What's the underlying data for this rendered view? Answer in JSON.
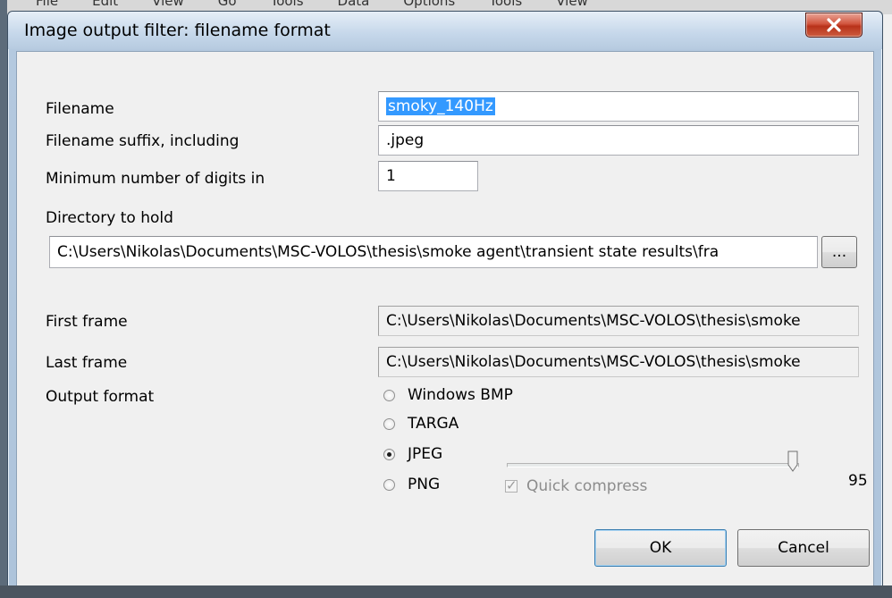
{
  "parent_menu": [
    "File",
    "Edit",
    "View",
    "Go",
    "Tools",
    "Data",
    "Options",
    "Tools",
    "View"
  ],
  "dialog": {
    "title": "Image output filter: filename format",
    "close_label": "x"
  },
  "form": {
    "filename_label": "Filename",
    "filename_value": "smoky_140Hz",
    "suffix_label": "Filename suffix, including",
    "suffix_value": ".jpeg",
    "digits_label": "Minimum number of digits in",
    "digits_value": "1",
    "directory_label": "Directory to hold",
    "directory_value": "C:\\Users\\Nikolas\\Documents\\MSC-VOLOS\\thesis\\smoke agent\\transient state results\\fra",
    "browse_label": "...",
    "first_frame_label": "First frame",
    "first_frame_value": "C:\\Users\\Nikolas\\Documents\\MSC-VOLOS\\thesis\\smoke",
    "last_frame_label": "Last frame",
    "last_frame_value": "C:\\Users\\Nikolas\\Documents\\MSC-VOLOS\\thesis\\smoke",
    "output_format_label": "Output format"
  },
  "formats": [
    {
      "label": "Windows BMP",
      "selected": false
    },
    {
      "label": "TARGA",
      "selected": false
    },
    {
      "label": "JPEG",
      "selected": true
    },
    {
      "label": "PNG",
      "selected": false
    }
  ],
  "quality": {
    "value": "95",
    "level_fraction": 0.95
  },
  "quick_compress": {
    "label": "Quick compress",
    "checked": true,
    "enabled": false
  },
  "buttons": {
    "ok": "OK",
    "cancel": "Cancel"
  },
  "colors": {
    "selection": "#3399ff",
    "close_button": "#c9452d",
    "title_gradient_top": "#e6eef7"
  }
}
